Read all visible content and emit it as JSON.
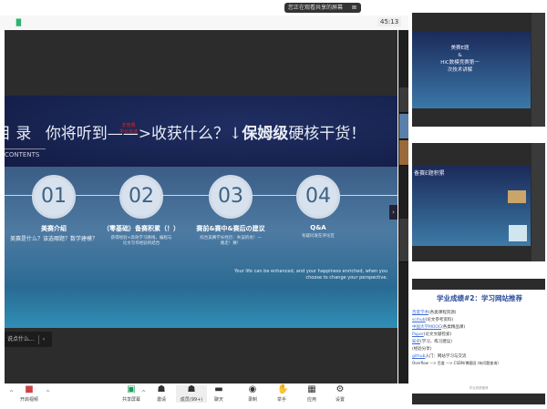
{
  "notification": {
    "text": "您正在观看共享的屏幕",
    "close": "⊠"
  },
  "meeting": {
    "timer": "45:13",
    "signal": "▐▌"
  },
  "slide": {
    "title_left": "目 录",
    "title_main": "你将听到——>收获什么？↓",
    "title_bold": "保姆级",
    "title_end": "硬核干货！",
    "red_tag": [
      "非竞赛",
      "学长自述"
    ],
    "contents_label": "CONTENTS",
    "items": [
      {
        "num": "01",
        "title": "美赛介绍",
        "sub": "美赛是什么？该选哪题？数学建模？"
      },
      {
        "num": "02",
        "title": "（零基础）备赛积累（！）",
        "sub": "获得经验+高效学习路线，编程与论文写作经验的结合"
      },
      {
        "num": "03",
        "title": "赛前&赛中&赛后の建议",
        "sub": "综合美赛学长经历：失误的坑！一路走！赛！"
      },
      {
        "num": "04",
        "title": "Q&A",
        "sub": "有疑问发在评论区"
      }
    ],
    "quote": "Your life can be enhanced, and your happiness enriched, when you choose to change your perspective."
  },
  "chat_pill": {
    "text": "说点什么...",
    "toggle": "‹"
  },
  "nav_arrow": "›",
  "toolbar": {
    "video": "开启视频",
    "share": "共享屏幕",
    "invite": "邀请",
    "members": "成员(99+)",
    "chat": "聊天",
    "record": "录制",
    "raise_hand": "举手",
    "apps": "应用",
    "settings": "设置"
  },
  "side": {
    "thumb1_title": [
      "美赛E题",
      "&",
      "HiC数模竞赛第一",
      "次技术讲解"
    ],
    "thumb2_title": "备赛E题积累",
    "doc_title": "学业成绩#2：学习网站推荐",
    "doc_lines": [
      {
        "link": "百度学术",
        "rest": "(各类课程资源)"
      },
      {
        "link": "scihub",
        "rest": "(论文参考资料)"
      },
      {
        "link": "中国大学MOOC",
        "rest": "(各类精品课)"
      },
      {
        "link": "Paper",
        "rest": "(论文文献检索)"
      },
      {
        "link": "知乎",
        "rest": "(学习、练习建议)"
      },
      {
        "link": "",
        "rest": "(经验分享)"
      },
      {
        "link": "github",
        "rest": "入门：网站学习与交流"
      },
      {
        "link": "",
        "rest": "Overflow —> 百度 —> CSDN/博客园 (有问题查询)"
      }
    ],
    "doc_footer": "学业成绩推荐"
  }
}
